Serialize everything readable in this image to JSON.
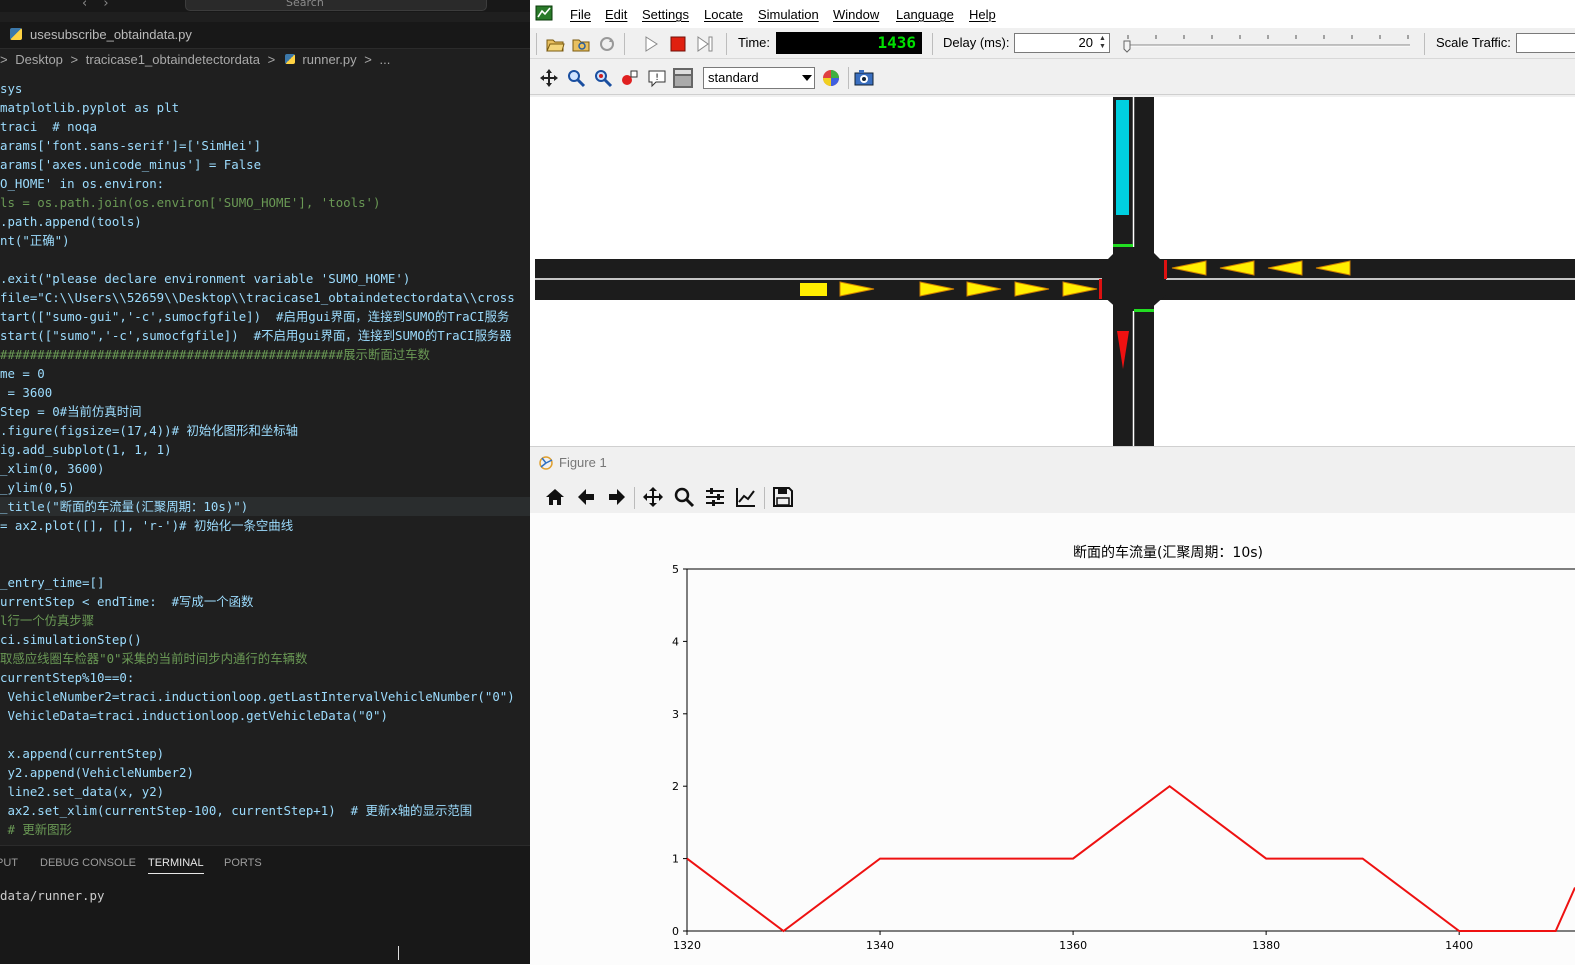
{
  "vscode": {
    "search_placeholder": "Search",
    "tab_label": "usesubscribe_obtaindata.py",
    "breadcrumb": {
      "parts": [
        "Desktop",
        "tracicase1_obtaindetectordata",
        "runner.py",
        "..."
      ],
      "seps": [
        ">",
        ">",
        ">",
        ">"
      ]
    },
    "code_lines": [
      "sys",
      "matplotlib.pyplot as plt",
      "traci  # noqa",
      "arams['font.sans-serif']=['SimHei']",
      "arams['axes.unicode_minus'] = False",
      "O_HOME' in os.environ:",
      "ls = os.path.join(os.environ['SUMO_HOME'], 'tools')",
      ".path.append(tools)",
      "nt(\"正确\")",
      "",
      ".exit(\"please declare environment variable 'SUMO_HOME')",
      "file=\"C:\\\\Users\\\\52659\\\\Desktop\\\\tracicase1_obtaindetectordata\\\\cross",
      "tart([\"sumo-gui\",'-c',sumocfgfile])  #启用gui界面，连接到SUMO的TraCI服务",
      "start([\"sumo\",'-c',sumocfgfile])  #不启用gui界面，连接到SUMO的TraCI服务器",
      "##############################################展示断面过车数",
      "me = 0",
      " = 3600",
      "Step = 0#当前仿真时间",
      ".figure(figsize=(17,4))# 初始化图形和坐标轴",
      "ig.add_subplot(1, 1, 1)",
      "_xlim(0, 3600)",
      "_ylim(0,5)",
      "_title(\"断面的车流量(汇聚周期：10s)\")",
      "= ax2.plot([], [], 'r-')# 初始化一条空曲线",
      "",
      "",
      "_entry_time=[]",
      "urrentStep < endTime:  #写成一个函数",
      "l行一个仿真步骤",
      "ci.simulationStep()",
      "取感应线圈车检器\"0\"采集的当前时间步内通行的车辆数",
      "currentStep%10==0:",
      " VehicleNumber2=traci.inductionloop.getLastIntervalVehicleNumber(\"0\")",
      " VehicleData=traci.inductionloop.getVehicleData(\"0\")",
      "",
      " x.append(currentStep)",
      " y2.append(VehicleNumber2)",
      " line2.set_data(x, y2)",
      " ax2.set_xlim(currentStep-100, currentStep+1)  # 更新x轴的显示范围",
      " # 更新图形"
    ],
    "panel_tabs": [
      "PUT",
      "DEBUG CONSOLE",
      "TERMINAL",
      "PORTS"
    ],
    "terminal_text": "data/runner.py"
  },
  "sumo": {
    "menu": [
      "File",
      "Edit",
      "Settings",
      "Locate",
      "Simulation",
      "Window",
      "Language",
      "Help"
    ],
    "time_label": "Time:",
    "time_value": "1436",
    "delay_label": "Delay (ms):",
    "delay_value": "20",
    "scale_label": "Scale Traffic:",
    "scheme_value": "standard",
    "colors": {
      "road": "#1c1c1c",
      "vehicle": "#ffee00",
      "cyan_vehicle": "#00d0e0",
      "red_vehicle": "#ee1111",
      "signal_green": "#22dd22",
      "signal_red": "#dd1111"
    }
  },
  "figure": {
    "window_title": "Figure 1",
    "toolbar_icons": [
      "home-icon",
      "back-arrow-icon",
      "forward-arrow-icon",
      "pan-icon",
      "zoom-icon",
      "configure-subplots-icon",
      "edit-axis-icon",
      "save-icon"
    ]
  },
  "chart_data": {
    "type": "line",
    "title": "断面的车流量(汇聚周期：10s)",
    "xlabel": "",
    "ylabel": "",
    "xlim": [
      1320,
      1412
    ],
    "ylim": [
      0,
      5
    ],
    "xticks": [
      1320,
      1340,
      1360,
      1380,
      1400
    ],
    "yticks": [
      0,
      1,
      2,
      3,
      4,
      5
    ],
    "series": [
      {
        "color": "#ee1111",
        "x": [
          1320,
          1330,
          1340,
          1350,
          1360,
          1370,
          1380,
          1390,
          1400,
          1410,
          1412
        ],
        "y": [
          1,
          0,
          1,
          1,
          1,
          2,
          1,
          1,
          0,
          0,
          0.6
        ]
      }
    ],
    "grid": false
  }
}
